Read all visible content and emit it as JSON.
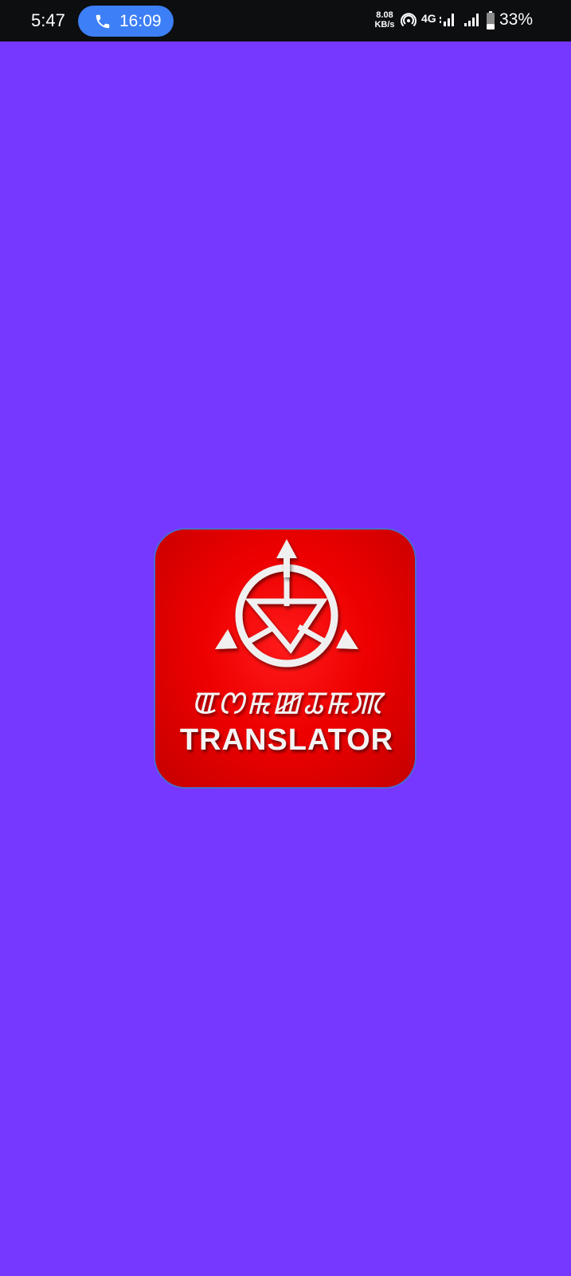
{
  "status_bar": {
    "time": "5:47",
    "call_duration": "16:09",
    "net_speed_value": "8.08",
    "net_speed_unit": "KB/s",
    "network_type": "4G",
    "battery_percent": "33%",
    "battery_level": 0.33
  },
  "splash": {
    "background_color": "#7637FF",
    "icon_script_text": "ꯑꯁꯃꯀꯊꯃꯄ",
    "icon_title": "TRANSLATOR",
    "icon_color": "#E60000"
  }
}
